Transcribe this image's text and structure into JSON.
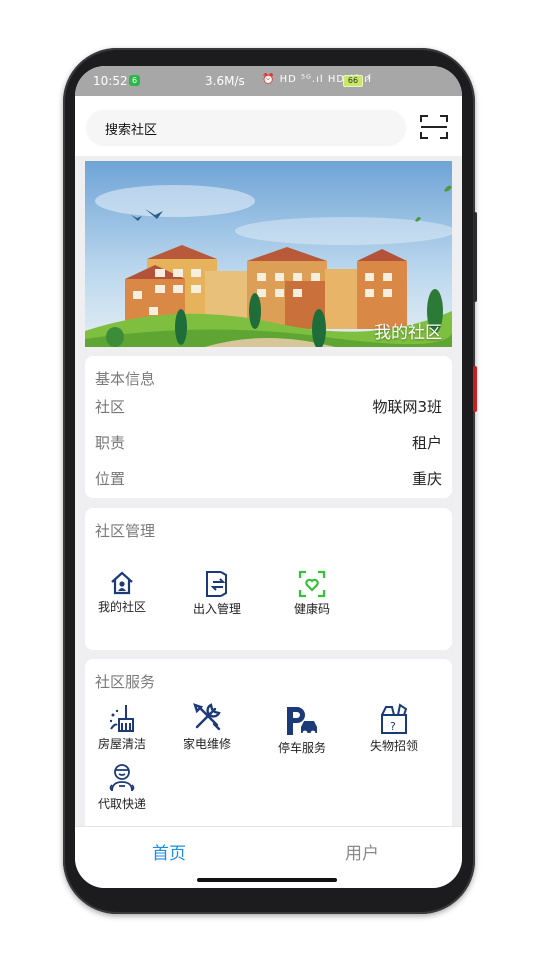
{
  "status_bar": {
    "time": "10:52",
    "notification_badge": "6",
    "speed": "3.6M/s",
    "indicators": "⏰ HD ⁵ᴳ.ıl HD ⁴ᴳ.ıl",
    "battery": "66",
    "charging_symbol": "⚡"
  },
  "search": {
    "placeholder": "搜索社区"
  },
  "banner": {
    "label": "我的社区"
  },
  "basic_info": {
    "title": "基本信息",
    "rows": [
      {
        "label": "社区",
        "value": "物联网3班"
      },
      {
        "label": "职责",
        "value": "租户"
      },
      {
        "label": "位置",
        "value": "重庆"
      }
    ]
  },
  "management": {
    "title": "社区管理",
    "items": [
      {
        "label": "我的社区",
        "icon": "house-person-icon"
      },
      {
        "label": "出入管理",
        "icon": "door-exit-icon"
      },
      {
        "label": "健康码",
        "icon": "health-code-icon"
      }
    ]
  },
  "services": {
    "title": "社区服务",
    "items": [
      {
        "label": "房屋清洁",
        "icon": "broom-icon"
      },
      {
        "label": "家电维修",
        "icon": "tools-icon"
      },
      {
        "label": "停车服务",
        "icon": "parking-icon"
      },
      {
        "label": "失物招领",
        "icon": "lost-found-icon"
      },
      {
        "label": "代取快递",
        "icon": "courier-icon"
      }
    ]
  },
  "tabs": [
    {
      "label": "首页",
      "active": true
    },
    {
      "label": "用户",
      "active": false
    }
  ],
  "colors": {
    "accent": "#1c8de0",
    "icon_navy": "#1d3a78",
    "icon_green": "#35c23a",
    "tab_inactive": "#8a8a8a"
  }
}
